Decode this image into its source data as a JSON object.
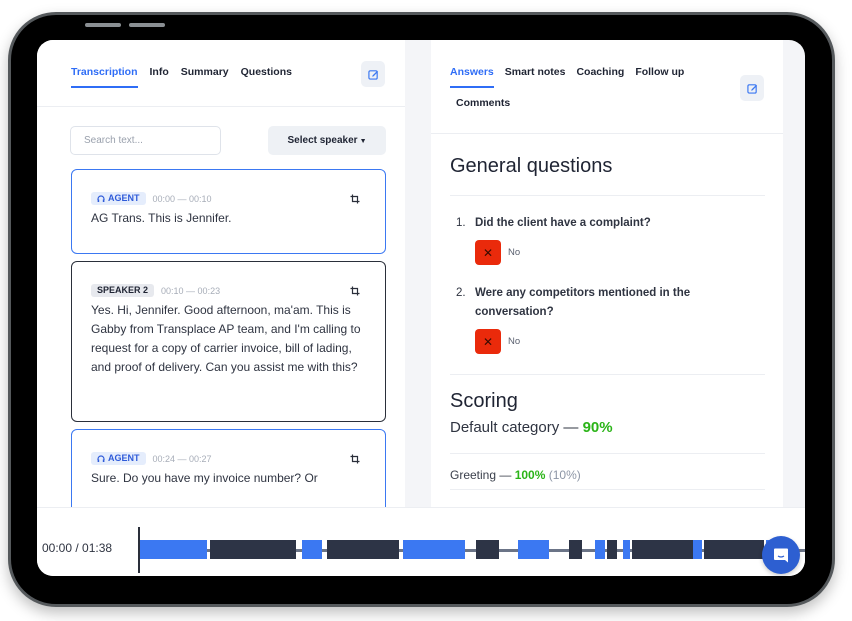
{
  "left_panel": {
    "tabs": [
      {
        "label": "Transcription",
        "active": true
      },
      {
        "label": "Info",
        "active": false
      },
      {
        "label": "Summary",
        "active": false
      },
      {
        "label": "Questions",
        "active": false
      }
    ],
    "search_placeholder": "Search text...",
    "select_speaker_label": "Select speaker",
    "transcript": [
      {
        "speaker": "AGENT",
        "type": "agent",
        "time": "00:00 — 00:10",
        "text": "AG Trans. This is Jennifer."
      },
      {
        "speaker": "SPEAKER 2",
        "type": "speaker",
        "time": "00:10 — 00:23",
        "text": "Yes. Hi, Jennifer. Good afternoon, ma'am. This is Gabby from Transplace AP team, and I'm calling to request for a copy of carrier invoice, bill of lading, and proof of delivery. Can you assist me with this?"
      },
      {
        "speaker": "AGENT",
        "type": "agent",
        "time": "00:24 — 00:27",
        "text": "Sure. Do you have my invoice number? Or"
      }
    ]
  },
  "right_panel": {
    "tabs": [
      {
        "label": "Answers",
        "active": true
      },
      {
        "label": "Smart notes",
        "active": false
      },
      {
        "label": "Coaching",
        "active": false
      },
      {
        "label": "Follow up",
        "active": false
      },
      {
        "label": "Comments",
        "active": false
      }
    ],
    "general_heading": "General questions",
    "questions": [
      {
        "num": "1.",
        "text": "Did the client have a complaint?",
        "answer": "No"
      },
      {
        "num": "2.",
        "text": "Were any competitors mentioned in the conversation?",
        "answer": "No"
      }
    ],
    "scoring_heading": "Scoring",
    "default_category": {
      "label": "Default category — ",
      "score": "90%"
    },
    "greeting": {
      "label": "Greeting — ",
      "score": "100%",
      "weight": "(10%)"
    }
  },
  "player": {
    "time_display": "00:00 / 01:38",
    "duration_seconds": 98,
    "segments": [
      {
        "speaker": "agent",
        "start": 0.0,
        "end": 10.0
      },
      {
        "speaker": "speaker2",
        "start": 10.4,
        "end": 23.1
      },
      {
        "speaker": "agent",
        "start": 24.0,
        "end": 27.0
      },
      {
        "speaker": "speaker2",
        "start": 27.7,
        "end": 38.3
      },
      {
        "speaker": "agent",
        "start": 38.9,
        "end": 48.0
      },
      {
        "speaker": "speaker2",
        "start": 49.6,
        "end": 53.0
      },
      {
        "speaker": "agent",
        "start": 55.7,
        "end": 60.3
      },
      {
        "speaker": "speaker2",
        "start": 63.3,
        "end": 65.2
      },
      {
        "speaker": "agent",
        "start": 67.1,
        "end": 68.5
      },
      {
        "speaker": "speaker2",
        "start": 68.8,
        "end": 70.4
      },
      {
        "speaker": "agent",
        "start": 71.2,
        "end": 72.3
      },
      {
        "speaker": "speaker2",
        "start": 72.6,
        "end": 81.5
      },
      {
        "speaker": "agent",
        "start": 81.5,
        "end": 82.8
      },
      {
        "speaker": "speaker2",
        "start": 83.1,
        "end": 91.9
      },
      {
        "speaker": "agent",
        "start": 92.3,
        "end": 96.0
      }
    ],
    "colors": {
      "agent": "#3b78f2",
      "speaker2": "#2d3446"
    }
  }
}
